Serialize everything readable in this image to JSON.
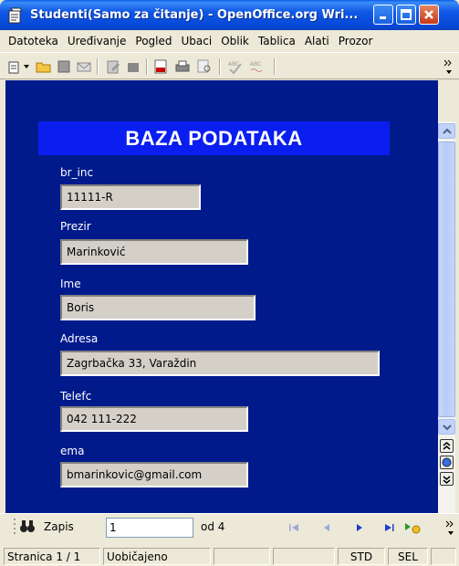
{
  "window": {
    "title": "Studenti(Samo za čitanje) - OpenOffice.org Wri..."
  },
  "menu": {
    "items": [
      {
        "label": "Datoteka"
      },
      {
        "label": "Uređivanje"
      },
      {
        "label": "Pogled"
      },
      {
        "label": "Ubaci"
      },
      {
        "label": "Oblik"
      },
      {
        "label": "Tablica"
      },
      {
        "label": "Alati"
      },
      {
        "label": "Prozor"
      }
    ]
  },
  "form": {
    "heading": "BAZA PODATAKA",
    "fields": [
      {
        "label": "br_inc",
        "value": "11111-R"
      },
      {
        "label": "Prezir",
        "value": "Marinković"
      },
      {
        "label": "Ime",
        "value": "Boris"
      },
      {
        "label": "Adresa",
        "value": "Zagrbačka 33, Varaždin"
      },
      {
        "label": "Telefc",
        "value": "042 111-222"
      },
      {
        "label": "ema",
        "value": "bmarinkovic@gmail.com"
      }
    ]
  },
  "record_nav": {
    "label": "Zapis",
    "current": "1",
    "of_text": "od 4"
  },
  "status": {
    "page": "Stranica 1 / 1",
    "style": "Uobičajeno",
    "std": "STD",
    "sel": "SEL"
  },
  "colors": {
    "document_background": "#001a8c",
    "header_background": "#0b1ef0"
  }
}
